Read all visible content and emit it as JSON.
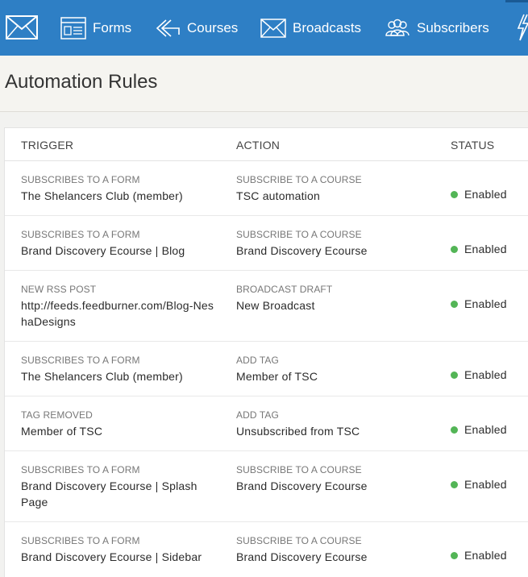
{
  "nav": {
    "items": [
      {
        "label": "Forms",
        "icon": "forms-icon"
      },
      {
        "label": "Courses",
        "icon": "courses-icon"
      },
      {
        "label": "Broadcasts",
        "icon": "broadcasts-icon"
      },
      {
        "label": "Subscribers",
        "icon": "subscribers-icon"
      }
    ],
    "accent_color": "#2e7fc5"
  },
  "page": {
    "title": "Automation Rules"
  },
  "table": {
    "headers": {
      "trigger": "TRIGGER",
      "action": "ACTION",
      "status": "STATUS"
    },
    "rows": [
      {
        "trigger_type": "SUBSCRIBES TO A FORM",
        "trigger_value": "The Shelancers Club (member)",
        "action_type": "SUBSCRIBE TO A COURSE",
        "action_value": "TSC automation",
        "status": "Enabled"
      },
      {
        "trigger_type": "SUBSCRIBES TO A FORM",
        "trigger_value": "Brand Discovery Ecourse | Blog",
        "action_type": "SUBSCRIBE TO A COURSE",
        "action_value": "Brand Discovery Ecourse",
        "status": "Enabled"
      },
      {
        "trigger_type": "NEW RSS POST",
        "trigger_value": "http://feeds.feedburner.com/Blog-NeshaDesigns",
        "action_type": "BROADCAST DRAFT",
        "action_value": "New Broadcast",
        "status": "Enabled"
      },
      {
        "trigger_type": "SUBSCRIBES TO A FORM",
        "trigger_value": "The Shelancers Club (member)",
        "action_type": "ADD TAG",
        "action_value": "Member of TSC",
        "status": "Enabled"
      },
      {
        "trigger_type": "TAG REMOVED",
        "trigger_value": "Member of TSC",
        "action_type": "ADD TAG",
        "action_value": "Unsubscribed from TSC",
        "status": "Enabled"
      },
      {
        "trigger_type": "SUBSCRIBES TO A FORM",
        "trigger_value": "Brand Discovery Ecourse | Splash Page",
        "action_type": "SUBSCRIBE TO A COURSE",
        "action_value": "Brand Discovery Ecourse",
        "status": "Enabled"
      },
      {
        "trigger_type": "SUBSCRIBES TO A FORM",
        "trigger_value": "Brand Discovery Ecourse | Sidebar",
        "action_type": "SUBSCRIBE TO A COURSE",
        "action_value": "Brand Discovery Ecourse",
        "status": "Enabled"
      }
    ],
    "status_color": "#53b556"
  }
}
